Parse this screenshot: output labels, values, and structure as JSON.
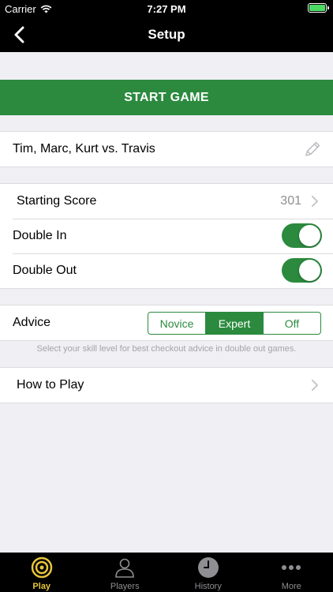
{
  "status_bar": {
    "carrier": "Carrier",
    "time": "7:27 PM"
  },
  "nav": {
    "title": "Setup",
    "back_icon": "chevron-left-icon"
  },
  "start_button": {
    "label": "START GAME"
  },
  "players": {
    "label": "Tim, Marc, Kurt vs. Travis",
    "edit_icon": "pencil-icon"
  },
  "settings": {
    "starting_score": {
      "label": "Starting Score",
      "value": "301"
    },
    "double_in": {
      "label": "Double In",
      "on": true
    },
    "double_out": {
      "label": "Double Out",
      "on": true
    }
  },
  "advice": {
    "label": "Advice",
    "options": [
      "Novice",
      "Expert",
      "Off"
    ],
    "selected": "Expert",
    "hint": "Select your skill level for best checkout advice in double out games."
  },
  "how_to_play": {
    "label": "How to Play"
  },
  "tabs": [
    {
      "label": "Play",
      "icon": "target-icon",
      "active": true
    },
    {
      "label": "Players",
      "icon": "person-icon",
      "active": false
    },
    {
      "label": "History",
      "icon": "clock-icon",
      "active": false
    },
    {
      "label": "More",
      "icon": "more-icon",
      "active": false
    }
  ],
  "colors": {
    "accent_green": "#2b8a3e",
    "tab_active": "#e8c53a",
    "background": "#efeff4"
  }
}
